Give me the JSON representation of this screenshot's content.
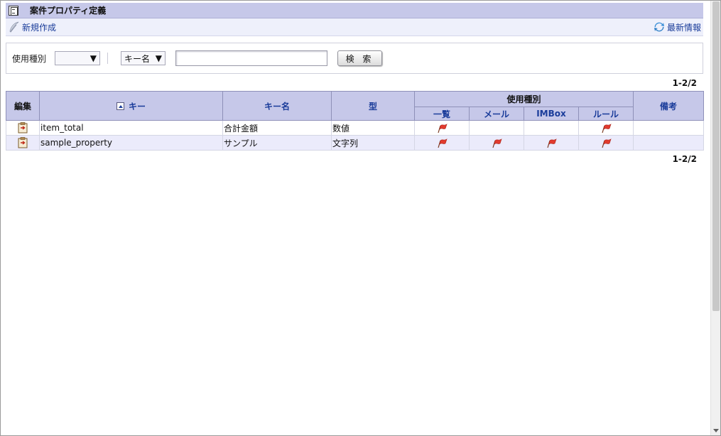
{
  "header": {
    "title": "案件プロパティ定義",
    "title_icon": "document-list-icon"
  },
  "actions": {
    "new_label": "新規作成",
    "refresh_label": "最新情報"
  },
  "search": {
    "type_label": "使用種別",
    "type_value": "",
    "key_select_value": "キー名",
    "input_value": "",
    "button_label": "検 索"
  },
  "pager": {
    "top": "1-2/2",
    "bottom": "1-2/2"
  },
  "table": {
    "headers": {
      "edit": "編集",
      "key": "キー",
      "key_name": "キー名",
      "type": "型",
      "usage": "使用種別",
      "usage_list": "一覧",
      "usage_mail": "メール",
      "usage_imbox": "IMBox",
      "usage_rule": "ルール",
      "remarks": "備考"
    },
    "rows": [
      {
        "key": "item_total",
        "key_name": "合計金額",
        "type": "数値",
        "usage_list": true,
        "usage_mail": false,
        "usage_imbox": false,
        "usage_rule": true,
        "remarks": ""
      },
      {
        "key": "sample_property",
        "key_name": "サンプル",
        "type": "文字列",
        "usage_list": true,
        "usage_mail": true,
        "usage_imbox": true,
        "usage_rule": true,
        "remarks": ""
      }
    ]
  },
  "colors": {
    "header_bg": "#c6c8e9",
    "link": "#1a3c9a",
    "alt_row": "#ebebfb",
    "flag": "#e23b2e"
  }
}
